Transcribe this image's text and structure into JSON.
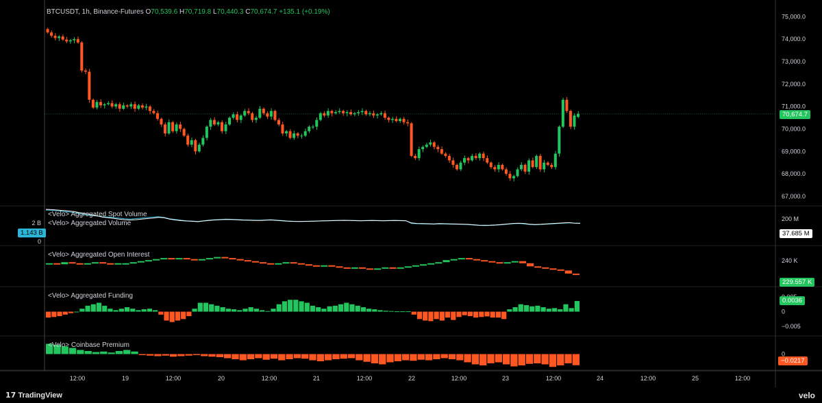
{
  "header": {
    "symbol": "BTCUSDT, 1h, Binance-Futures",
    "o_key": "O",
    "o": "70,539.6",
    "h_key": "H",
    "h": "70,719.8",
    "l_key": "L",
    "l": "70,440.3",
    "c_key": "C",
    "c": "70,674.7",
    "change": "+135.1 (+0.19%)"
  },
  "panes": {
    "spot_volume": "<Velo> Aggregated Spot Volume",
    "agg_volume": "<Velo> Aggregated Volume",
    "open_interest": "<Velo> Aggregated Open Interest",
    "funding": "<Velo> Aggregated Funding",
    "premium": "<Velo> Coinbase Premium"
  },
  "left_scale": {
    "top": "2 B",
    "badge": "1.143 B",
    "bottom": "0"
  },
  "badges": {
    "price": "70,674.7",
    "volume": "37.685 M",
    "oi": "229.557 K",
    "funding": "0.0036",
    "premium": "−0.0217"
  },
  "right_axis": {
    "price_ticks": [
      "75,000.0",
      "74,000.0",
      "73,000.0",
      "72,000.0",
      "71,000.0",
      "70,000.0",
      "69,000.0",
      "68,000.0",
      "67,000.0"
    ],
    "volume_ticks": [
      "200 M"
    ],
    "oi_ticks": [
      "240 K"
    ],
    "funding_ticks": [
      "0.005",
      "0",
      "−0.005"
    ],
    "premium_ticks": [
      "0"
    ]
  },
  "x_axis": {
    "labels": [
      "12:00",
      "19",
      "12:00",
      "20",
      "12:00",
      "21",
      "12:00",
      "22",
      "12:00",
      "23",
      "12:00",
      "24",
      "12:00",
      "25",
      "12:00"
    ]
  },
  "footer": {
    "brand": "TradingView",
    "velo": "velo"
  },
  "colors": {
    "up": "#22c55e",
    "down": "#ff5722",
    "spot_line": "#2bb5d6",
    "volume_line": "#ffffff",
    "grid": "#1a1a1a"
  },
  "chart_data": {
    "type": "candlestick",
    "interval": "1h",
    "price_range": [
      66600,
      75500
    ],
    "price_close": [
      74300,
      74150,
      74050,
      74120,
      73980,
      73900,
      73950,
      74000,
      73850,
      72600,
      72550,
      71300,
      70950,
      71200,
      71050,
      71100,
      71150,
      71000,
      71100,
      70900,
      71050,
      71000,
      71100,
      70900,
      71050,
      70950,
      71000,
      70800,
      70700,
      70450,
      70200,
      69800,
      70300,
      69900,
      70200,
      70000,
      69700,
      69300,
      69500,
      69000,
      69300,
      69600,
      70100,
      70400,
      70200,
      70300,
      69900,
      70200,
      70500,
      70650,
      70400,
      70600,
      70800,
      70700,
      70400,
      70500,
      70900,
      70700,
      70550,
      70800,
      70400,
      70200,
      69800,
      69900,
      69600,
      69800,
      69700,
      69700,
      69900,
      70100,
      70100,
      70400,
      70700,
      70600,
      70800,
      70700,
      70750,
      70800,
      70700,
      70750,
      70650,
      70700,
      70750,
      70800,
      70650,
      70700,
      70600,
      70650,
      70700,
      70500,
      70400,
      70450,
      70350,
      70450,
      70300,
      70250,
      68800,
      68700,
      69100,
      69200,
      69300,
      69400,
      69200,
      69100,
      68900,
      68800,
      68600,
      68400,
      68200,
      68500,
      68700,
      68600,
      68800,
      68700,
      68900,
      68700,
      68500,
      68300,
      68200,
      68400,
      68200,
      68000,
      67800,
      67900,
      68200,
      68400,
      68100,
      68600,
      68300,
      68800,
      68200,
      68500,
      68400,
      68300,
      68900,
      70100,
      71300,
      70800,
      70100,
      70600,
      70674.7
    ],
    "price_open": [
      74450,
      74300,
      74150,
      74050,
      74120,
      73980,
      73900,
      73950,
      74000,
      73850,
      72600,
      72550,
      71300,
      70950,
      71200,
      71050,
      71100,
      71150,
      71000,
      71100,
      70900,
      71050,
      71000,
      71100,
      70900,
      71050,
      70950,
      71000,
      70800,
      70700,
      70450,
      70200,
      69800,
      70300,
      69900,
      70200,
      70000,
      69700,
      69300,
      69500,
      69000,
      69300,
      69600,
      70100,
      70400,
      70200,
      70300,
      69900,
      70200,
      70500,
      70650,
      70400,
      70600,
      70800,
      70700,
      70400,
      70500,
      70900,
      70700,
      70550,
      70800,
      70400,
      70200,
      69800,
      69900,
      69600,
      69800,
      69700,
      69700,
      69900,
      70100,
      70100,
      70400,
      70700,
      70600,
      70800,
      70700,
      70750,
      70800,
      70700,
      70750,
      70650,
      70700,
      70750,
      70800,
      70650,
      70700,
      70600,
      70650,
      70700,
      70500,
      70400,
      70450,
      70350,
      70450,
      70300,
      70250,
      68800,
      68700,
      69100,
      69200,
      69300,
      69400,
      69200,
      69100,
      68900,
      68800,
      68600,
      68400,
      68200,
      68500,
      68700,
      68600,
      68800,
      68700,
      68900,
      68700,
      68500,
      68300,
      68200,
      68400,
      68200,
      68000,
      67800,
      67900,
      68200,
      68400,
      68100,
      68600,
      68300,
      68800,
      68200,
      68500,
      68400,
      68300,
      68900,
      70100,
      71300,
      70800,
      70100,
      70539.6
    ],
    "last_price": 70674.7,
    "volume_range": [
      0,
      260
    ],
    "spot_volume": [
      250,
      248,
      245,
      240,
      236,
      230,
      222,
      215,
      210,
      205,
      200,
      198,
      195,
      190,
      185,
      183,
      186,
      190,
      194,
      198,
      200,
      195,
      185,
      180,
      175,
      170,
      168,
      165,
      170,
      175,
      178,
      180,
      182,
      181,
      179,
      177,
      176,
      175,
      174,
      176,
      178,
      175,
      172,
      168,
      166,
      165,
      166,
      167,
      168,
      170,
      171,
      172,
      173,
      174,
      173,
      172,
      171,
      172,
      173,
      172,
      171,
      172,
      173,
      172,
      171,
      150,
      148,
      147,
      146,
      145,
      147,
      146,
      145,
      144,
      143,
      141,
      138,
      135,
      134,
      135,
      137,
      140,
      144,
      148,
      150,
      147,
      142,
      140,
      142,
      145,
      147,
      150,
      152,
      154,
      153,
      152
    ],
    "aggregated_volume": [
      255,
      253,
      250,
      246,
      243,
      238,
      230,
      222,
      216,
      208,
      198,
      193,
      188,
      182,
      178,
      176,
      178,
      182,
      186,
      190,
      196,
      192,
      182,
      176,
      171,
      168,
      166,
      163,
      168,
      172,
      176,
      178,
      180,
      179,
      177,
      175,
      174,
      173,
      172,
      174,
      176,
      173,
      170,
      167,
      165,
      164,
      165,
      166,
      167,
      169,
      170,
      171,
      172,
      173,
      172,
      171,
      170,
      171,
      172,
      171,
      170,
      171,
      172,
      171,
      170,
      154,
      150,
      149,
      148,
      147,
      149,
      148,
      147,
      146,
      145,
      143,
      140,
      137,
      136,
      137,
      139,
      142,
      146,
      150,
      152,
      150,
      145,
      142,
      144,
      147,
      149,
      152,
      154,
      156,
      152,
      151
    ],
    "open_interest_range": [
      220,
      255
    ],
    "open_interest": [
      240,
      239,
      241,
      240,
      239,
      240,
      241,
      240,
      239,
      240,
      240,
      241,
      242,
      243,
      244,
      245,
      244,
      245,
      244,
      243,
      244,
      245,
      246,
      245,
      244,
      243,
      242,
      241,
      240,
      239,
      240,
      241,
      240,
      239,
      238,
      237,
      238,
      237,
      236,
      235,
      236,
      235,
      234,
      235,
      236,
      235,
      236,
      237,
      238,
      239,
      240,
      241,
      243,
      244,
      245,
      244,
      243,
      242,
      241,
      240,
      241,
      242,
      240,
      237,
      236,
      235,
      234,
      233,
      230,
      229.557
    ],
    "funding_range": [
      -0.0075,
      0.0075
    ],
    "funding": [
      -0.002,
      -0.0018,
      -0.0015,
      -0.001,
      -0.0005,
      0,
      0.001,
      0.002,
      0.0025,
      0.003,
      0.002,
      0.001,
      0.0005,
      0.001,
      0.0015,
      0.001,
      0.0005,
      0.0008,
      0.001,
      0.0005,
      -0.001,
      -0.003,
      -0.0035,
      -0.003,
      -0.0025,
      -0.0015,
      0.001,
      0.003,
      0.003,
      0.0025,
      0.002,
      0.0015,
      0.001,
      0.0008,
      0.0005,
      0.001,
      0.0015,
      0.001,
      0.0005,
      0.0002,
      0.001,
      0.0025,
      0.0035,
      0.004,
      0.004,
      0.0035,
      0.003,
      0.002,
      0.0015,
      0.001,
      0.0018,
      0.002,
      0.0025,
      0.003,
      0.0025,
      0.002,
      0.0015,
      0.001,
      0.0008,
      0.0005,
      0.0003,
      0.0002,
      0.0001,
      0.0001,
      0.0001,
      -0.001,
      -0.0025,
      -0.003,
      -0.0032,
      -0.0025,
      -0.003,
      -0.002,
      -0.0028,
      -0.0018,
      -0.0012,
      -0.0015,
      -0.002,
      -0.0018,
      -0.0016,
      -0.002,
      -0.002,
      -0.0025,
      0.0008,
      0.0015,
      0.0025,
      0.0022,
      0.0018,
      0.002,
      0.0015,
      0.001,
      0.0012,
      0.0008,
      0.0025,
      0.0012,
      0.0036
    ],
    "premium_range": [
      -0.03,
      0.03
    ],
    "coinbase_premium": [
      0.02,
      0.018,
      0.015,
      0.012,
      0.008,
      0.006,
      0.004,
      0.005,
      0.003,
      0.006,
      0.008,
      0.005,
      -0.002,
      -0.003,
      -0.004,
      -0.003,
      -0.005,
      -0.004,
      -0.003,
      -0.002,
      -0.004,
      -0.005,
      -0.006,
      -0.008,
      -0.01,
      -0.012,
      -0.01,
      -0.008,
      -0.011,
      -0.009,
      -0.012,
      -0.01,
      -0.008,
      -0.009,
      -0.012,
      -0.014,
      -0.012,
      -0.01,
      -0.009,
      -0.008,
      -0.012,
      -0.015,
      -0.018,
      -0.02,
      -0.016,
      -0.014,
      -0.012,
      -0.013,
      -0.011,
      -0.012,
      -0.01,
      -0.008,
      -0.01,
      -0.012,
      -0.016,
      -0.02,
      -0.022,
      -0.018,
      -0.016,
      -0.02,
      -0.024,
      -0.022,
      -0.019,
      -0.018,
      -0.02,
      -0.025,
      -0.022,
      -0.018,
      -0.0217
    ]
  }
}
